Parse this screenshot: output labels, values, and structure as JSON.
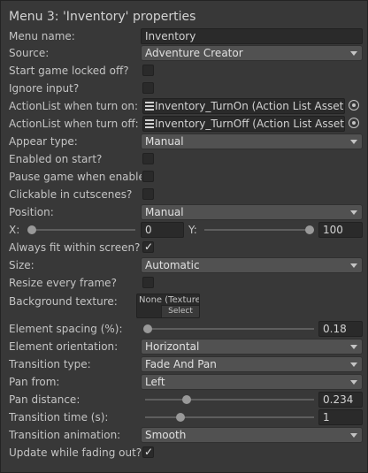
{
  "title": "Menu 3: 'Inventory' properties",
  "menu_name": {
    "label": "Menu name:",
    "value": "Inventory"
  },
  "source": {
    "label": "Source:",
    "value": "Adventure Creator"
  },
  "start_locked": {
    "label": "Start game locked off?",
    "checked": false
  },
  "ignore_input": {
    "label": "Ignore input?",
    "checked": false
  },
  "action_on": {
    "label": "ActionList when turn on:",
    "value": "Inventory_TurnOn (Action List Asset)"
  },
  "action_off": {
    "label": "ActionList when turn off:",
    "value": "Inventory_TurnOff (Action List Asset)"
  },
  "appear_type": {
    "label": "Appear type:",
    "value": "Manual"
  },
  "enabled_start": {
    "label": "Enabled on start?",
    "checked": false
  },
  "pause_game": {
    "label": "Pause game when enabled",
    "checked": false
  },
  "clickable_cutscenes": {
    "label": "Clickable in cutscenes?",
    "checked": false
  },
  "position": {
    "label": "Position:",
    "value": "Manual"
  },
  "pos_x": {
    "label": "X:",
    "value": "0",
    "fraction": 0
  },
  "pos_y": {
    "label": "Y:",
    "value": "100",
    "fraction": 1
  },
  "fit_screen": {
    "label": "Always fit within screen?",
    "checked": true,
    "check_glyph": "✓"
  },
  "size": {
    "label": "Size:",
    "value": "Automatic"
  },
  "resize_frame": {
    "label": "Resize every frame?",
    "checked": false
  },
  "background_texture": {
    "label": "Background texture:",
    "value": "None (Texture",
    "select_label": "Select"
  },
  "element_spacing": {
    "label": "Element spacing (%):",
    "value": "0.18",
    "fraction": 0.0
  },
  "element_orientation": {
    "label": "Element orientation:",
    "value": "Horizontal"
  },
  "transition_type": {
    "label": "Transition type:",
    "value": "Fade And Pan"
  },
  "pan_from": {
    "label": "Pan from:",
    "value": "Left"
  },
  "pan_distance": {
    "label": "Pan distance:",
    "value": "0.234",
    "fraction": 0.234
  },
  "transition_time": {
    "label": "Transition time (s):",
    "value": "1",
    "fraction": 0.2
  },
  "transition_animation": {
    "label": "Transition animation:",
    "value": "Smooth"
  },
  "update_fading": {
    "label": "Update while fading out?",
    "checked": true,
    "check_glyph": "✓"
  },
  "colors": {
    "panel": "#383838",
    "field": "#2a2a2a",
    "dropdown": "#515151",
    "text": "#c4c4c4"
  },
  "icons": {
    "dropdown": "chevron-down-icon",
    "picker": "object-picker-icon",
    "asset": "action-list-asset-icon"
  }
}
